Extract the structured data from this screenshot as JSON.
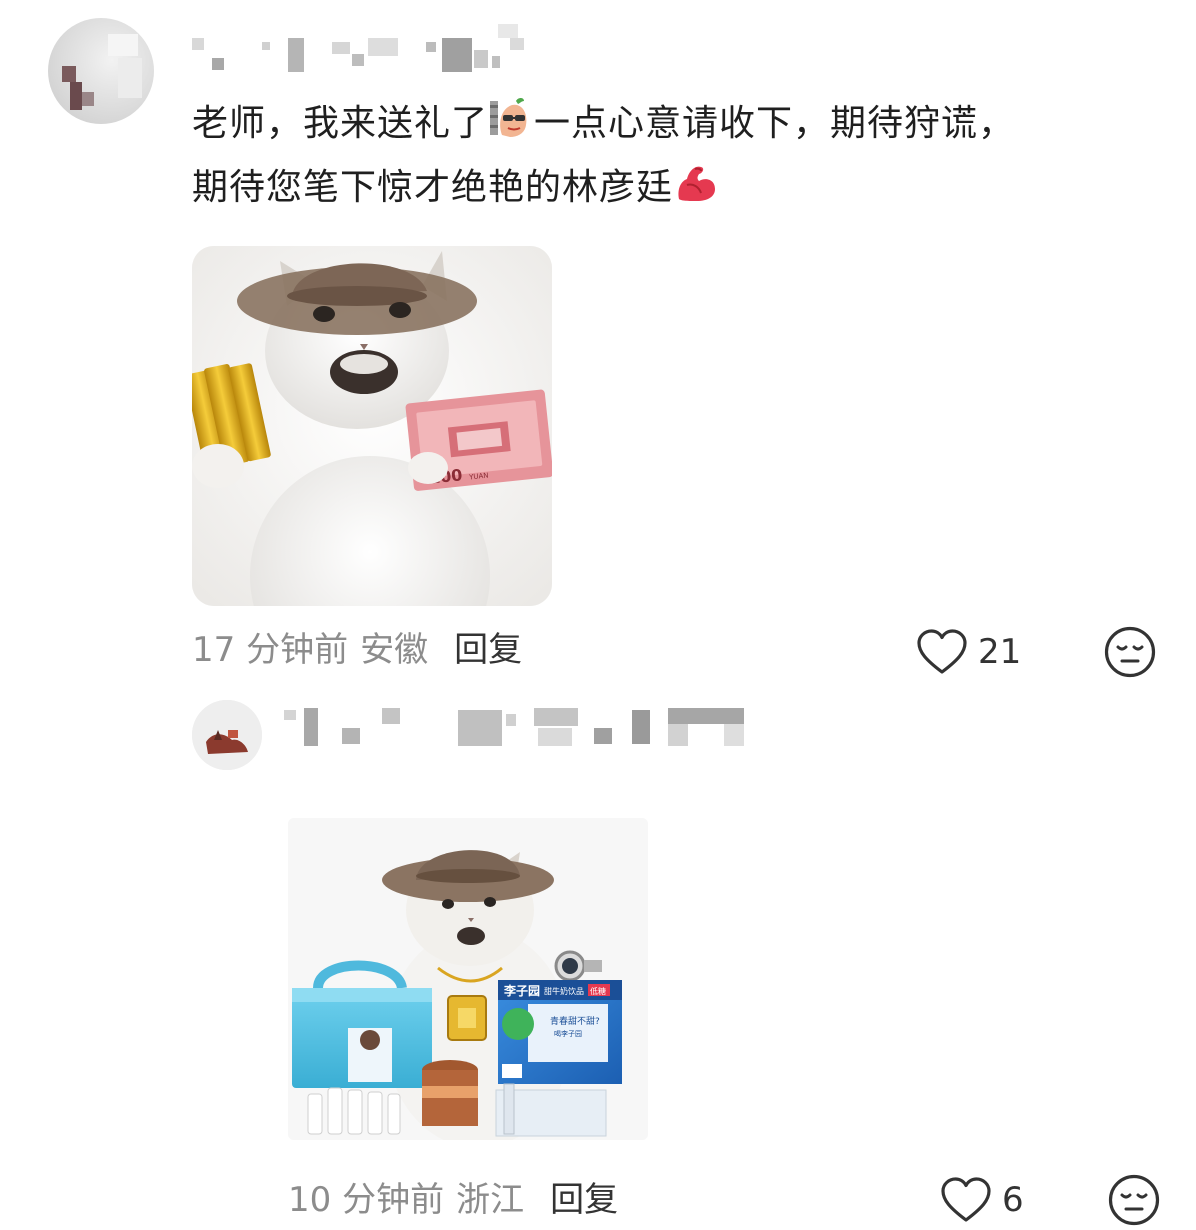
{
  "comment": {
    "text_line1_a": "老师，我来送礼了",
    "text_line1_b": "一点心意请收下，期待狩谎，",
    "text_line2": "期待您笔下惊才绝艳的林彦廷",
    "emoji_1": "peanut-sunglasses-emoji",
    "emoji_2": "flexed-biceps-emoji",
    "image": {
      "money_label": "100",
      "money_sub": "YUAN"
    },
    "time": "17 分钟前",
    "location": "安徽",
    "reply_label": "回复",
    "likes": "21",
    "like_icon": "heart-outline-icon",
    "dislike_icon": "meh-face-icon"
  },
  "reply": {
    "image": {
      "box_brand": "李子园",
      "box_subtitle": "甜牛奶饮品",
      "box_tag": "低糖",
      "box_slogan": "青春甜不甜?",
      "box_slogan_2": "喝李子园"
    },
    "time": "10 分钟前",
    "location": "浙江",
    "reply_label": "回复",
    "likes": "6",
    "like_icon": "heart-outline-icon",
    "dislike_icon": "meh-face-icon"
  },
  "colors": {
    "text": "#1f1f1f",
    "meta": "#8c8c8c",
    "icon": "#333333",
    "money_pink": "#e6949a",
    "gold": "#d9a521",
    "box_blue": "#2f7fd1",
    "bag_cyan": "#5cc6e6"
  }
}
